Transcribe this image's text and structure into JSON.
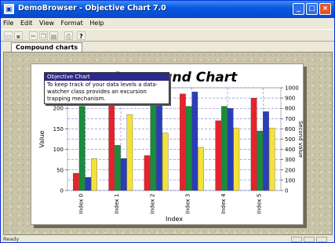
{
  "window": {
    "title": "DemoBrowser - Objective Chart 7.0",
    "app_icon": "app-icon"
  },
  "menu": [
    "File",
    "Edit",
    "View",
    "Format",
    "Help"
  ],
  "toolbar": {
    "help_glyph": "?"
  },
  "tabs": [
    {
      "label": "Compound charts",
      "active": true
    }
  ],
  "tooltip": {
    "title": "Objective Chart",
    "body": "To keep track of your data levels a data-watcher class provides an excursion trapping mechanism."
  },
  "status": {
    "text": "Ready"
  },
  "colors": {
    "red": "#e8212b",
    "green": "#1a8c3c",
    "blue": "#2a3eb8",
    "yellow": "#f4e23a"
  },
  "chart_data": {
    "type": "bar",
    "title": "Compound Chart",
    "xlabel": "Index",
    "ylabel": "Value",
    "y2label": "Second value",
    "categories": [
      "Index 0",
      "Index 1",
      "Index 2",
      "Index 3",
      "Index 4",
      "Index 5"
    ],
    "ylim": [
      0,
      250
    ],
    "yticks": [
      0,
      50,
      100,
      150,
      200
    ],
    "y2lim": [
      0,
      1000
    ],
    "y2ticks": [
      0,
      100,
      200,
      300,
      400,
      500,
      600,
      700,
      800,
      900,
      1000
    ],
    "grid": true,
    "series": [
      {
        "color": "red",
        "values": [
          42,
          215,
          85,
          235,
          170,
          225
        ]
      },
      {
        "color": "green",
        "values": [
          205,
          110,
          210,
          205,
          205,
          145
        ]
      },
      {
        "color": "blue",
        "values": [
          32,
          78,
          230,
          240,
          200,
          192
        ]
      },
      {
        "color": "yellow",
        "values": [
          78,
          185,
          140,
          105,
          152,
          152
        ]
      }
    ]
  }
}
